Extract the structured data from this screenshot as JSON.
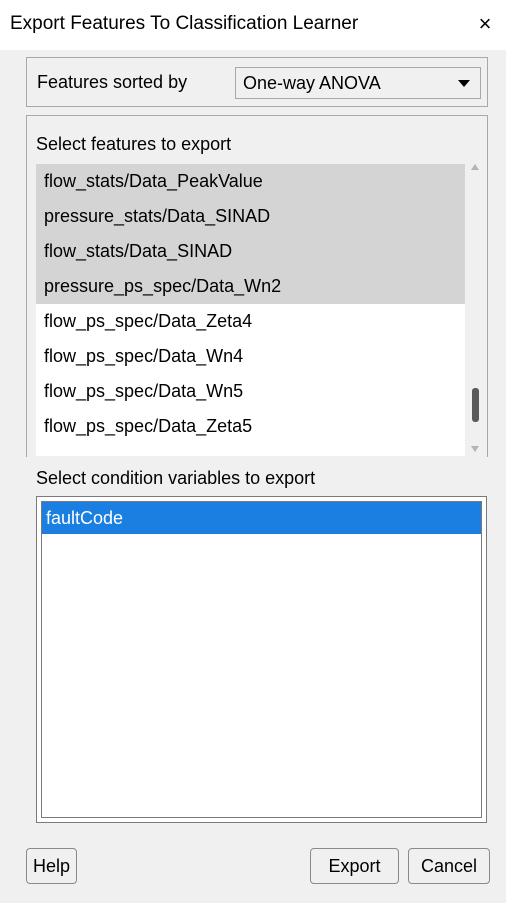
{
  "window": {
    "title": "Export Features To Classification Learner",
    "close_label": "×"
  },
  "sort": {
    "label": "Features sorted by",
    "selected": "One-way ANOVA"
  },
  "features": {
    "label": "Select features to export",
    "items": [
      {
        "label": "flow_stats/Data_PeakValue",
        "selected": true
      },
      {
        "label": "pressure_stats/Data_SINAD",
        "selected": true
      },
      {
        "label": "flow_stats/Data_SINAD",
        "selected": true
      },
      {
        "label": "pressure_ps_spec/Data_Wn2",
        "selected": true
      },
      {
        "label": "flow_ps_spec/Data_Zeta4",
        "selected": false
      },
      {
        "label": "flow_ps_spec/Data_Wn4",
        "selected": false
      },
      {
        "label": "flow_ps_spec/Data_Wn5",
        "selected": false
      },
      {
        "label": "flow_ps_spec/Data_Zeta5",
        "selected": false
      }
    ]
  },
  "conditions": {
    "label": "Select condition variables to export",
    "items": [
      {
        "label": "faultCode",
        "selected": true
      }
    ]
  },
  "buttons": {
    "help": "Help",
    "export": "Export",
    "cancel": "Cancel"
  }
}
